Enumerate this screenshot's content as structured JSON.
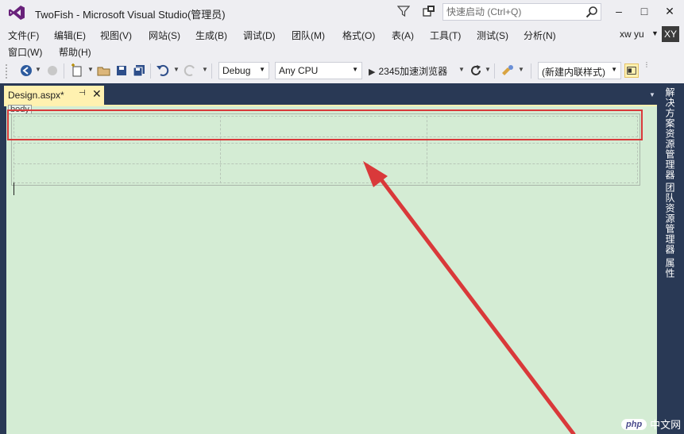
{
  "window": {
    "title": "TwoFish - Microsoft Visual Studio(管理员)",
    "quick_launch_placeholder": "快速启动 (Ctrl+Q)",
    "minimize": "–",
    "maximize": "□",
    "close": "✕"
  },
  "menu": {
    "row1": [
      "文件(F)",
      "编辑(E)",
      "视图(V)",
      "网站(S)",
      "生成(B)",
      "调试(D)",
      "团队(M)",
      "格式(O)",
      "表(A)",
      "工具(T)",
      "测试(S)",
      "分析(N)"
    ],
    "row2": [
      "窗口(W)",
      "帮助(H)"
    ]
  },
  "user": {
    "name": "xw yu",
    "initials": "XY"
  },
  "toolbar": {
    "configuration": "Debug",
    "platform": "Any CPU",
    "run_target": "2345加速浏览器",
    "style_target": "(新建内联样式)"
  },
  "editor": {
    "tab_title": "Design.aspx*",
    "pin_glyph": "⊣",
    "close_glyph": "✕",
    "body_tag": "body"
  },
  "side_tabs": [
    "解决方案资源管理器",
    "团队资源管理器",
    "属性"
  ],
  "watermark": {
    "badge": "php",
    "text": "中文网"
  },
  "colors": {
    "accent_red": "#d9393a",
    "vs_purple": "#68217a",
    "tab_active": "#fff1b0",
    "designer_bg": "#d4ecd4",
    "chrome_dark": "#293955"
  }
}
